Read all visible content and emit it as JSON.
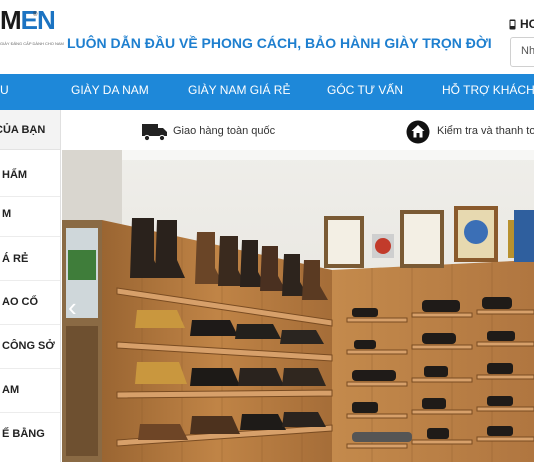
{
  "header": {
    "logo_m": "M",
    "logo_en": "EN",
    "logo_reg": "®",
    "logo_tagline": "GIÀY ĐẲNG CẤP DÀNH CHO NAM",
    "slogan": "LUÔN DẪN ĐẦU VỀ PHONG CÁCH, BẢO HÀNH GIÀY TRỌN ĐỜI",
    "hotline_label": "HO",
    "search_placeholder": "Nh"
  },
  "nav": {
    "items": [
      "U",
      "GIÀY DA NAM",
      "GIÀY NAM GIÁ RẺ",
      "GÓC TƯ VẤN",
      "HỖ TRỢ KHÁCH H"
    ]
  },
  "sidebar": {
    "title": "CỦA BẠN",
    "items": [
      "HẨM",
      "M",
      "Á RẺ",
      "AO CỔ",
      "CÔNG SỞ",
      "AM",
      "Ế BẰNG"
    ]
  },
  "info_strip": {
    "shipping": "Giao hàng toàn quốc",
    "inspect": "Kiểm tra và thanh to"
  },
  "banner": {
    "prev_arrow": "‹"
  },
  "colors": {
    "brand_blue": "#1e88d9",
    "slogan_blue": "#1e7fcf",
    "shelf_wood": "#b77a3f"
  }
}
